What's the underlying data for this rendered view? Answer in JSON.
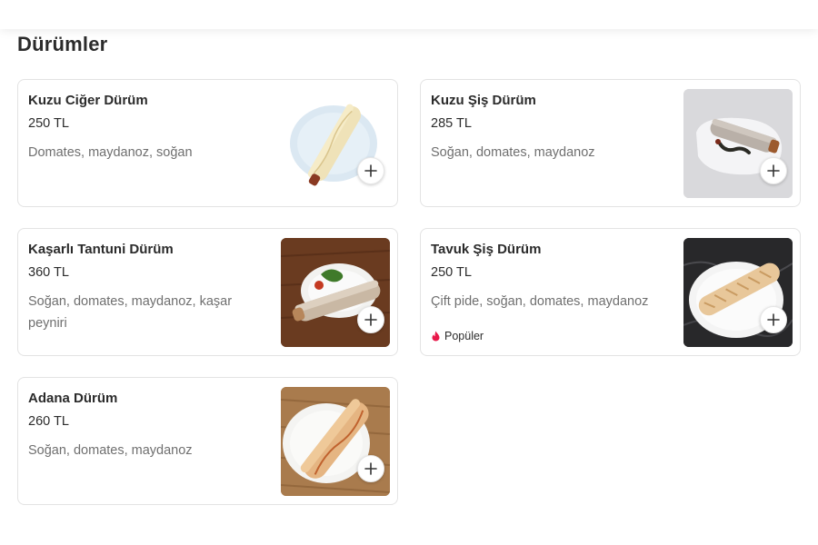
{
  "section": {
    "title": "Dürümler"
  },
  "colors": {
    "accent": "#e8194a",
    "card_border": "#e3e3e3",
    "desc_text": "#6f6f6f"
  },
  "products": [
    {
      "name": "Kuzu Ciğer Dürüm",
      "price": "250 TL",
      "description": "Domates, maydanoz, soğan",
      "badge": "",
      "image": "dürüm on light blue plate",
      "add_icon": "plus-icon"
    },
    {
      "name": "Kuzu Şiş Dürüm",
      "price": "285 TL",
      "description": "Soğan, domates, maydanoz",
      "badge": "",
      "image": "dürüm on white plate with grilled pepper",
      "add_icon": "plus-icon"
    },
    {
      "name": "Kaşarlı Tantuni Dürüm",
      "price": "360 TL",
      "description": "Soğan, domates, maydanoz, kaşar peyniri",
      "badge": "",
      "image": "dürüm with greens on wooden table",
      "add_icon": "plus-icon"
    },
    {
      "name": "Tavuk Şiş Dürüm",
      "price": "250 TL",
      "description": "Çift pide, soğan, domates, maydanoz",
      "badge": "Popüler",
      "badge_icon": "flame-icon",
      "image": "dürüm on white plate on dark marble",
      "add_icon": "plus-icon"
    },
    {
      "name": "Adana Dürüm",
      "price": "260 TL",
      "description": "Soğan, domates, maydanoz",
      "badge": "",
      "image": "dürüm on white plate on wood",
      "add_icon": "plus-icon"
    }
  ]
}
